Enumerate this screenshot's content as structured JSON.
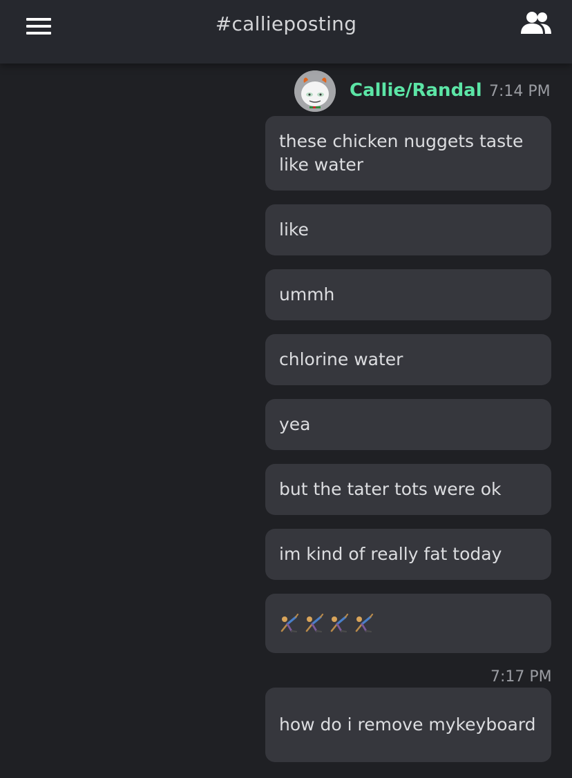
{
  "header": {
    "channel": "#callieposting"
  },
  "message_group_1": {
    "author": "Callie/Randal",
    "time": "7:14 PM",
    "messages": [
      "these chicken nuggets taste like water",
      "like",
      "ummh",
      "chlorine water",
      "yea",
      "but the tater tots were ok",
      "im kind of really fat today"
    ],
    "emoji_message": [
      "🤸",
      "🤸",
      "🤸",
      "🤸"
    ]
  },
  "message_group_2": {
    "time": "7:17 PM",
    "messages": [
      "how do i remove mykeyboard"
    ]
  },
  "icons": {
    "menu": "hamburger-menu-icon",
    "members": "members-icon",
    "emoji": "person-cartwheeling-emoji"
  },
  "colors": {
    "author_name": "#5ce5a6",
    "background": "#1f2024",
    "header": "#26282e",
    "bubble": "#36373d"
  }
}
